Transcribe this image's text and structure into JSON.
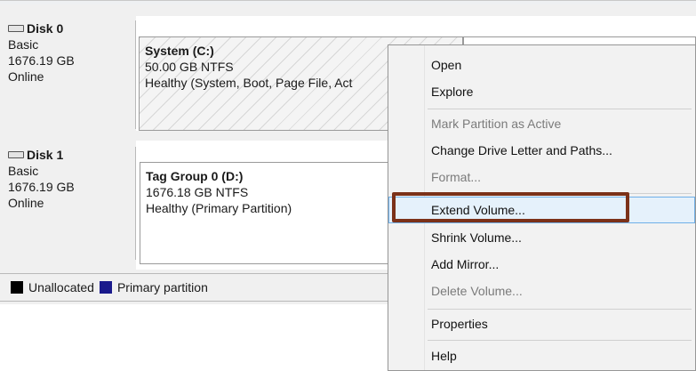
{
  "disks": [
    {
      "name": "Disk 0",
      "type": "Basic",
      "size": "1676.19 GB",
      "status": "Online"
    },
    {
      "name": "Disk 1",
      "type": "Basic",
      "size": "1676.19 GB",
      "status": "Online"
    }
  ],
  "volumes": {
    "system": {
      "title": "System  (C:)",
      "size_fs": "50.00 GB NTFS",
      "status": "Healthy (System, Boot, Page File, Act"
    },
    "tag": {
      "title": "Tag Group 0  (D:)",
      "size_fs": "1676.18 GB NTFS",
      "status": "Healthy (Primary Partition)"
    }
  },
  "legend": {
    "unallocated": "Unallocated",
    "primary": "Primary partition",
    "colors": {
      "unallocated": "#000000",
      "primary": "#1a1a8c"
    }
  },
  "context_menu": {
    "open": "Open",
    "explore": "Explore",
    "mark_active": "Mark Partition as Active",
    "change_letter": "Change Drive Letter and Paths...",
    "format": "Format...",
    "extend": "Extend Volume...",
    "shrink": "Shrink Volume...",
    "add_mirror": "Add Mirror...",
    "delete": "Delete Volume...",
    "properties": "Properties",
    "help": "Help"
  },
  "colors": {
    "highlight_fill": "#e5f1fb",
    "highlight_border": "#6fb0e8",
    "callout": "#7b3119"
  }
}
